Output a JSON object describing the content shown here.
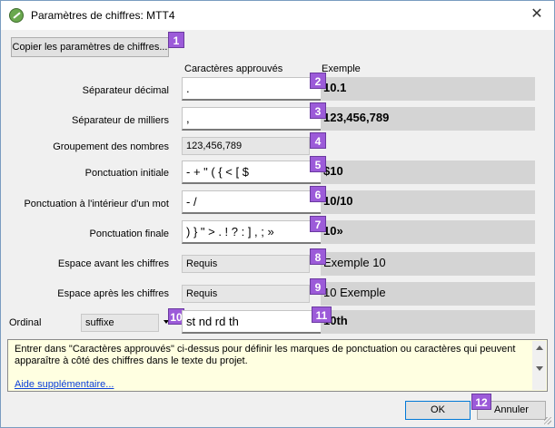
{
  "window": {
    "title": "Paramètres de chiffres: MTT4",
    "close_symbol": "✕"
  },
  "buttons": {
    "copy": "Copier les paramètres de chiffres...",
    "ok": "OK",
    "cancel": "Annuler"
  },
  "columns": {
    "approved": "Caractères approuvés",
    "example": "Exemple"
  },
  "rows": [
    {
      "label": "Séparateur décimal",
      "value": ".",
      "example": "10.1",
      "badge": "1"
    },
    {
      "label": "Séparateur de milliers",
      "value": ",",
      "example": "123,456,789"
    },
    {
      "label": "Groupement des nombres",
      "value": "123,456,789"
    },
    {
      "label": "Ponctuation initiale",
      "value": "- + \" ( { < [ $",
      "example": "$10"
    },
    {
      "label": "Ponctuation à l'intérieur d'un mot",
      "value": "- /",
      "example": "10/10"
    },
    {
      "label": "Ponctuation finale",
      "value": ") } \" > . ! ? : ] , ; »",
      "example": "10»"
    },
    {
      "label": "Espace avant les chiffres",
      "value": "Requis",
      "example": "Exemple 10"
    },
    {
      "label": "Espace après les chiffres",
      "value": "Requis",
      "example": "10 Exemple"
    }
  ],
  "ordinal": {
    "label": "Ordinal",
    "select_value": "suffixe",
    "value": "st nd rd th",
    "example": "10th"
  },
  "info": {
    "text": "Entrer dans \"Caractères approuvés\" ci-dessus pour définir les marques de ponctuation ou caractères qui peuvent apparaître à côté des chiffres dans le texte du projet.",
    "link": "Aide supplémentaire..."
  },
  "badges": [
    "1",
    "2",
    "3",
    "4",
    "5",
    "6",
    "7",
    "8",
    "9",
    "10",
    "11",
    "12"
  ],
  "colors": {
    "badge": "#9c5bd9",
    "link": "#0b3fd9",
    "info_bg": "#ffffe1",
    "ok_border": "#0078d7"
  }
}
